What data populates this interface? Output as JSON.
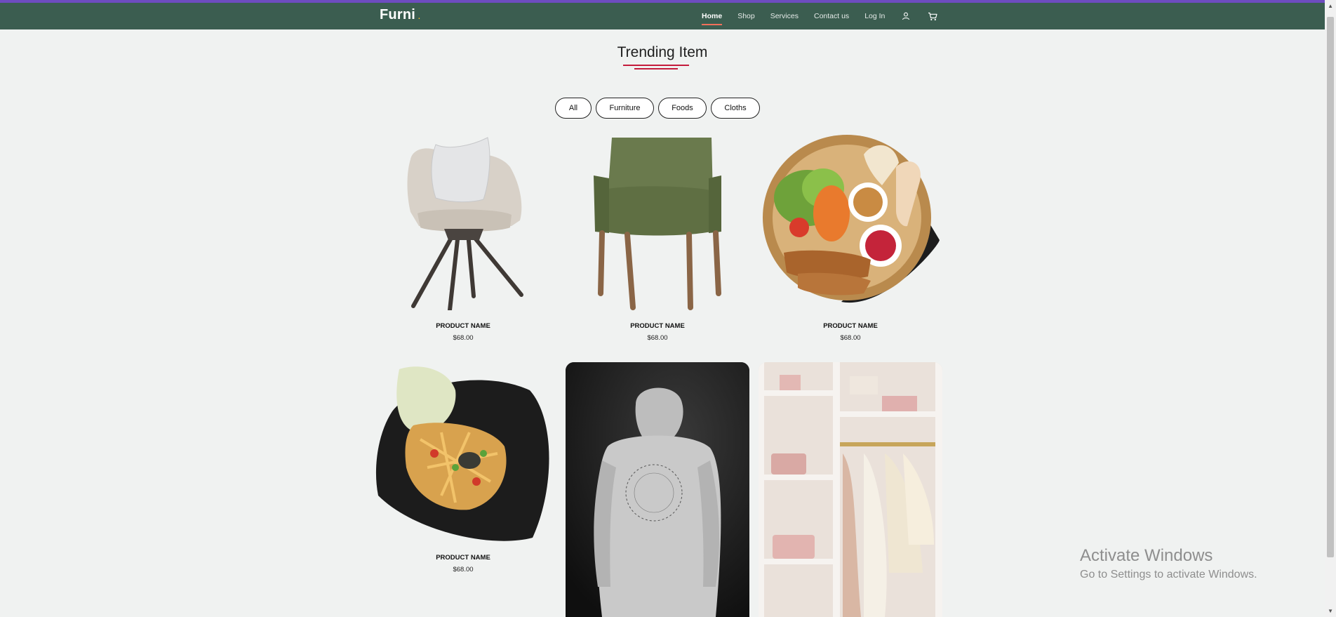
{
  "nav": {
    "brand": "Furni",
    "brand_dot": ".",
    "links": [
      "Home",
      "Shop",
      "Services",
      "Contact us",
      "Log In"
    ],
    "active": "Home",
    "icons": [
      "user-icon",
      "cart-icon"
    ]
  },
  "section": {
    "title": "Trending Item"
  },
  "filters": [
    "All",
    "Furniture",
    "Foods",
    "Cloths"
  ],
  "products": [
    {
      "name": "PRODUCT NAME",
      "price": "$68.00",
      "image": "beige-armchair-with-pillow"
    },
    {
      "name": "PRODUCT NAME",
      "price": "$68.00",
      "image": "green-dining-chair"
    },
    {
      "name": "PRODUCT NAME",
      "price": "$68.00",
      "image": "spring-rolls-salad-basket"
    },
    {
      "name": "PRODUCT NAME",
      "price": "$68.00",
      "image": "papaya-salad-plate"
    },
    {
      "image": "grey-hoodie-back"
    },
    {
      "image": "closet-shelves-clothes"
    }
  ],
  "watermark": {
    "line1": "Activate Windows",
    "line2": "Go to Settings to activate Windows."
  },
  "colors": {
    "navbar": "#3b5d50",
    "accent": "#f2705a",
    "underline": "#c41b3c",
    "background": "#f0f2f1"
  }
}
